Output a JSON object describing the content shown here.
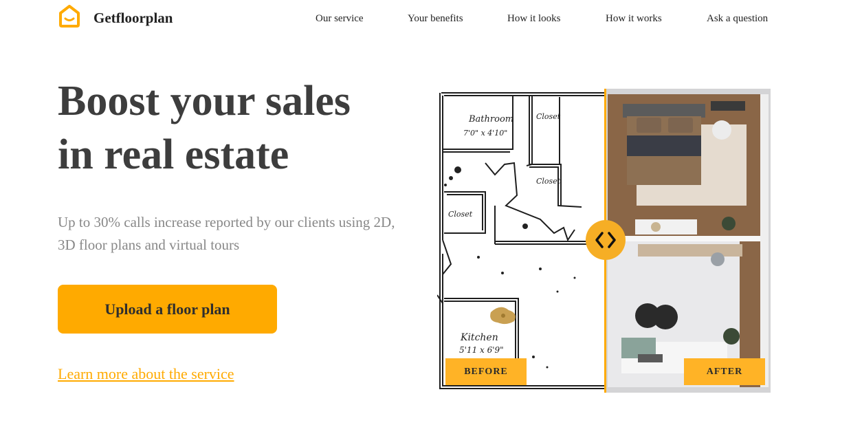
{
  "brand": {
    "name": "Getfloorplan",
    "logo_icon": "house-icon",
    "accent_color": "#ffaa00"
  },
  "nav": {
    "items": [
      {
        "label": "Our service"
      },
      {
        "label": "Your benefits"
      },
      {
        "label": "How it looks"
      },
      {
        "label": "How it works"
      },
      {
        "label": "Ask a question"
      }
    ]
  },
  "hero": {
    "title_line1": "Boost your sales",
    "title_line2": "in real estate",
    "subtitle": "Up to 30% calls increase reported by our clients using 2D, 3D floor plans and virtual tours",
    "cta_label": "Upload a floor plan",
    "learn_more_label": "Learn more about the service"
  },
  "comparison": {
    "before_label": "BEFORE",
    "after_label": "AFTER",
    "handle_icon": "chevron-left-right-icon",
    "sketch_labels": {
      "bathroom": "Bathroom",
      "bathroom_size": "7'0\" x 4'10\"",
      "closet_1": "Closet",
      "closet_2": "Closet",
      "closet_3": "Closet",
      "kitchen": "Kitchen",
      "kitchen_size": "5'11 x 6'9\""
    }
  }
}
